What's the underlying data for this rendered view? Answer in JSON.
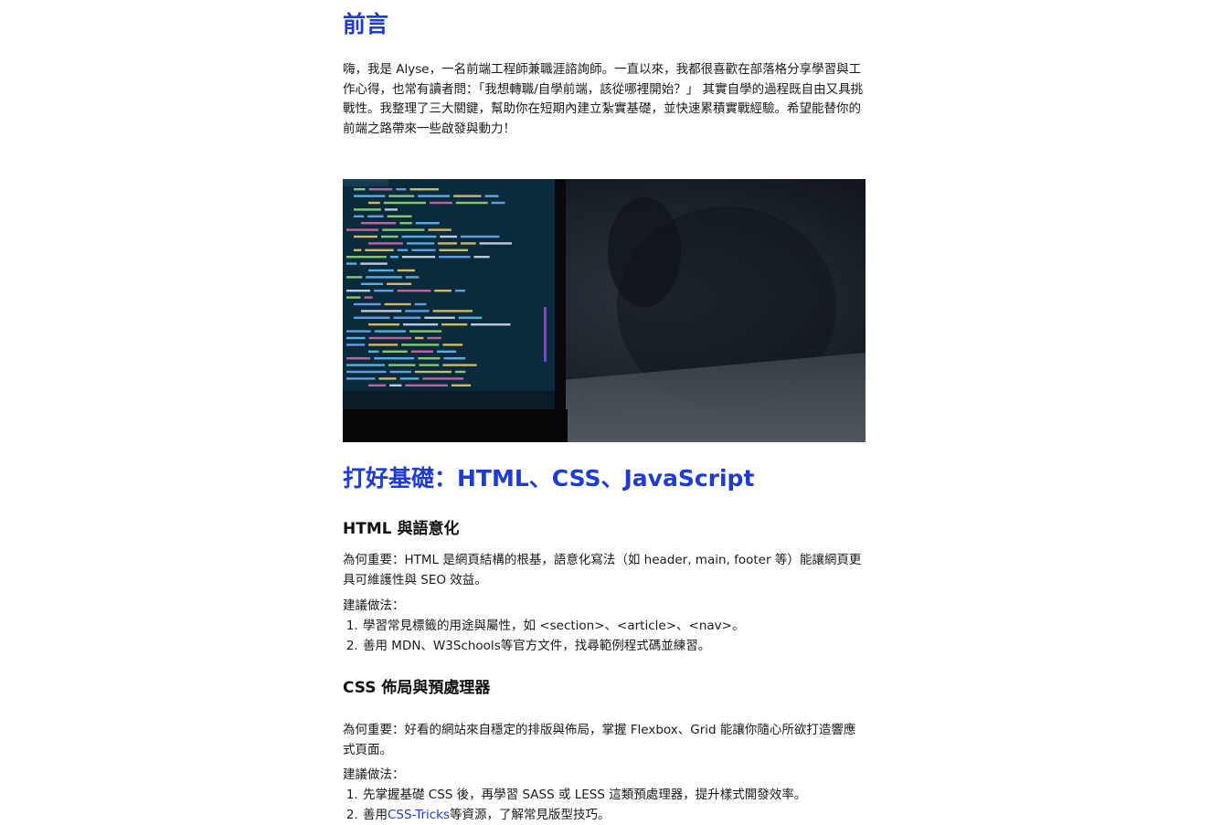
{
  "intro": {
    "heading": "前言",
    "paragraph": "嗨，我是 Alyse，一名前端工程師兼職涯諮詢師。一直以來，我都很喜歡在部落格分享學習與工作心得，也常有讀者問：「我想轉職/自學前端，該從哪裡開始？」 其實自學的過程既自由又具挑戰性。我整理了三大關鍵，幫助你在短期內建立紮實基礎，並快速累積實戰經驗。希望能替你的前端之路帶來一些啟發與動力！"
  },
  "hero_image": {
    "subject": "laptop showing code editor",
    "colors": {
      "screen": "#0b2a3c",
      "dark": "#121820"
    }
  },
  "basics": {
    "heading": "打好基礎：HTML、CSS、JavaScript",
    "html": {
      "heading": "HTML 與語意化",
      "why": "為何重要：HTML 是網頁結構的根基，語意化寫法（如 header, main, footer 等）能讓網頁更具可維護性與 SEO 效益。",
      "how_label": "建議做法：",
      "steps": [
        "學習常見標籤的用途與屬性，如 <section>、<article>、<nav>。",
        "善用 MDN、W3Schools等官方文件，找尋範例程式碼並練習。"
      ]
    },
    "css": {
      "heading": "CSS 佈局與預處理器",
      "why": "為何重要：好看的網站來自穩定的排版與佈局，掌握 Flexbox、Grid 能讓你隨心所欲打造響應式頁面。",
      "how_label": "建議做法：",
      "step1": "先掌握基礎 CSS 後，再學習 SASS 或 LESS 這類預處理器，提升樣式開發效率。",
      "step2_before": "善用",
      "step2_link": "CSS-Tricks",
      "step2_after": "等資源，了解常見版型技巧。"
    }
  },
  "colors": {
    "accent": "#1f3bd6",
    "text": "#1a1a1a"
  }
}
